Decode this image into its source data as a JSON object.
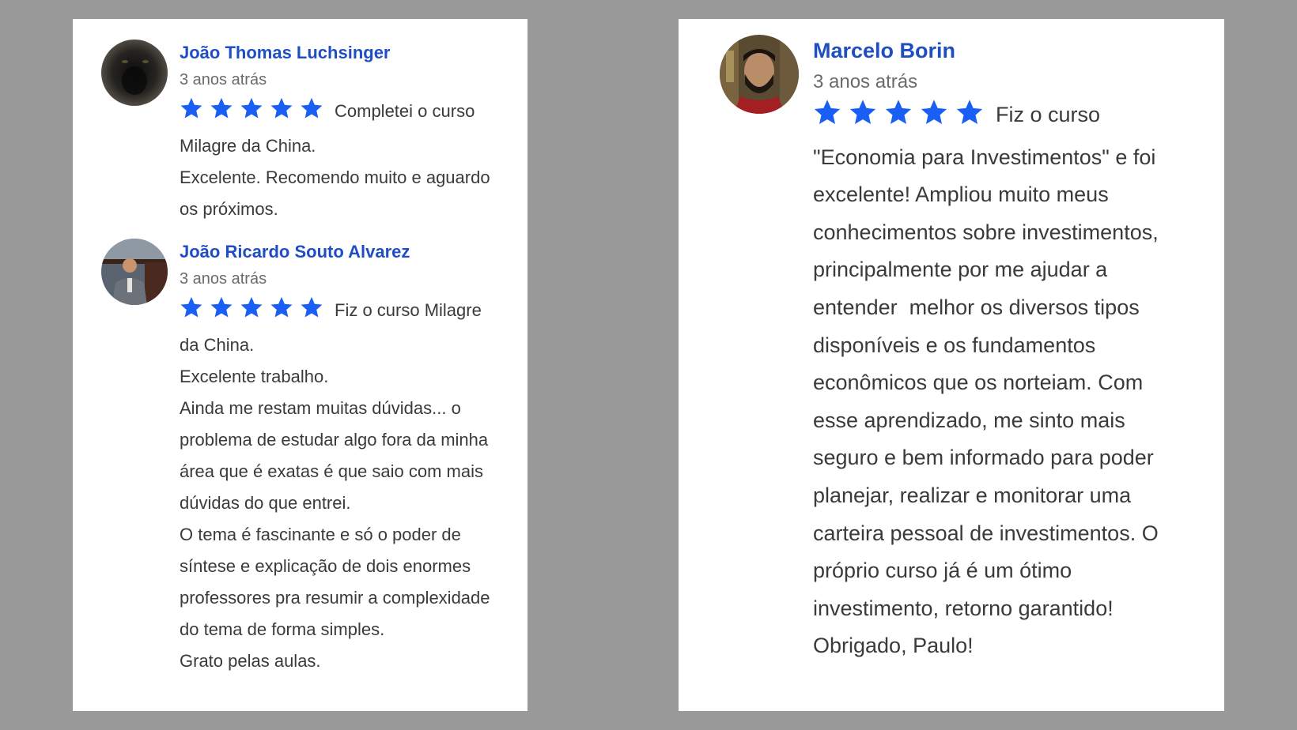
{
  "colors": {
    "background": "#999999",
    "card": "#ffffff",
    "name": "#1f4ec2",
    "star": "#1a5ff5",
    "text": "#3a3a3a",
    "date": "#6b6b6b"
  },
  "reviews": [
    {
      "name": "João Thomas Luchsinger",
      "date": "3 anos atrás",
      "rating": 5,
      "avatar_icon": "cat-photo-avatar",
      "lead": "Completei o curso Milagre da China.",
      "paragraphs": [
        "Excelente. Recomendo muito e aguardo os próximos."
      ]
    },
    {
      "name": "João Ricardo Souto Alvarez",
      "date": "3 anos atrás",
      "rating": 5,
      "avatar_icon": "person-photo-avatar",
      "lead": "Fiz o curso Milagre da China.",
      "paragraphs": [
        "Excelente trabalho.",
        "Ainda me restam muitas dúvidas... o problema de estudar algo fora da minha área que é exatas é que saio com mais dúvidas do que entrei.",
        "O tema é fascinante e só o poder de síntese e explicação de dois enormes professores pra resumir a complexidade do tema de forma simples.",
        "Grato pelas aulas."
      ]
    },
    {
      "name": "Marcelo Borin",
      "date": "3 anos atrás",
      "rating": 5,
      "avatar_icon": "bearded-man-photo-avatar",
      "lead": "Fiz o curso \"Economia para Investimentos\" e foi excelente! Ampliou muito meus conhecimentos sobre investimentos, principalmente por me ajudar a entender  melhor os diversos tipos disponíveis e os fundamentos econômicos que os norteiam. Com esse aprendizado, me sinto mais seguro e bem informado para poder planejar, realizar e monitorar uma carteira pessoal de investimentos. O próprio curso já é um ótimo investimento, retorno garantido! Obrigado, Paulo!",
      "paragraphs": []
    }
  ]
}
